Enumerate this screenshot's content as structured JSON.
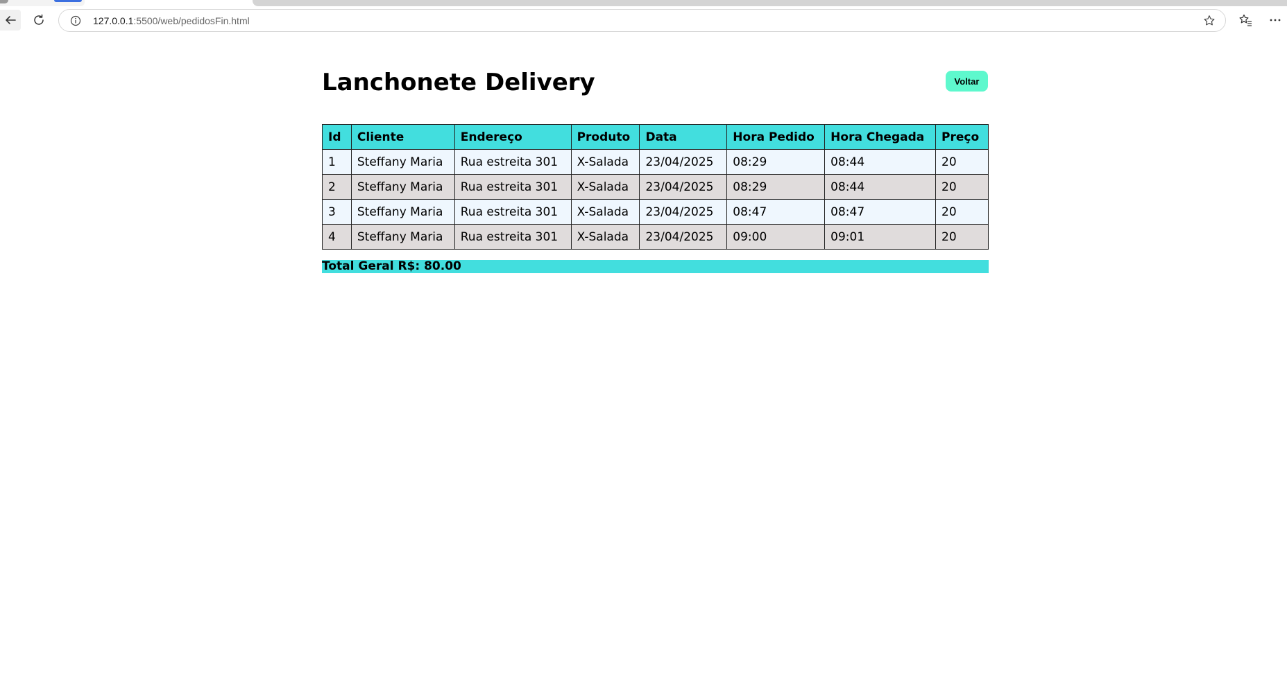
{
  "browser": {
    "url_host": "127.0.0.1",
    "url_rest": ":5500/web/pedidosFin.html"
  },
  "page": {
    "title": "Lanchonete Delivery",
    "back_button_label": "Voltar"
  },
  "table": {
    "headers": [
      "Id",
      "Cliente",
      "Endereço",
      "Produto",
      "Data",
      "Hora Pedido",
      "Hora Chegada",
      "Preço"
    ],
    "rows": [
      {
        "id": "1",
        "cliente": "Steffany Maria",
        "endereco": "Rua estreita 301",
        "produto": "X-Salada",
        "data": "23/04/2025",
        "hora_pedido": "08:29",
        "hora_chegada": "08:44",
        "preco": "20"
      },
      {
        "id": "2",
        "cliente": "Steffany Maria",
        "endereco": "Rua estreita 301",
        "produto": "X-Salada",
        "data": "23/04/2025",
        "hora_pedido": "08:29",
        "hora_chegada": "08:44",
        "preco": "20"
      },
      {
        "id": "3",
        "cliente": "Steffany Maria",
        "endereco": "Rua estreita 301",
        "produto": "X-Salada",
        "data": "23/04/2025",
        "hora_pedido": "08:47",
        "hora_chegada": "08:47",
        "preco": "20"
      },
      {
        "id": "4",
        "cliente": "Steffany Maria",
        "endereco": "Rua estreita 301",
        "produto": "X-Salada",
        "data": "23/04/2025",
        "hora_pedido": "09:00",
        "hora_chegada": "09:01",
        "preco": "20"
      }
    ]
  },
  "total": {
    "text": "Total Geral R$: 80.00"
  },
  "colors": {
    "header_bg": "#42dede",
    "row_odd_bg": "#eff7fe",
    "row_even_bg": "#e0dcdc",
    "button_bg": "#5ef8cd",
    "active_tab_indicator": "#3b6fe0"
  },
  "icons": {
    "back": "arrow-left-icon",
    "reload": "reload-icon",
    "site_info": "info-icon",
    "favorite": "star-icon",
    "favorites_bar": "favorites-icon",
    "menu": "more-icon"
  }
}
